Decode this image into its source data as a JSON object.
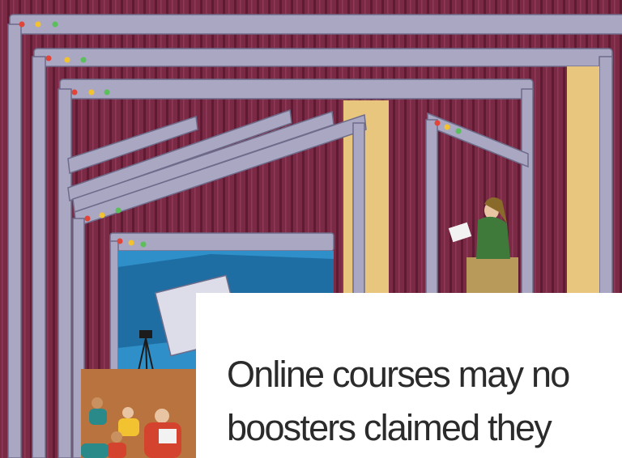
{
  "illustration": {
    "subject": "nested browser windows on a stage curtain",
    "colors": {
      "curtain": "#7a2a45",
      "curtain_stripe": "#5c1c33",
      "window_frame": "#a9a7c2",
      "window_frame_shadow": "#8a88a6",
      "spotlight": "#e8c67d",
      "traffic_red": "#e0453a",
      "traffic_yellow": "#f2c230",
      "traffic_green": "#5bbf5b",
      "screen_blue": "#2f8fc8",
      "stage_floor": "#b9733f"
    },
    "icons": [
      "traffic-light-dots-icon",
      "camera-tripod-icon",
      "lecturer-figure",
      "audience-figures"
    ]
  },
  "article": {
    "headline_line1": "Online courses may no",
    "headline_line2": "boosters claimed they"
  }
}
